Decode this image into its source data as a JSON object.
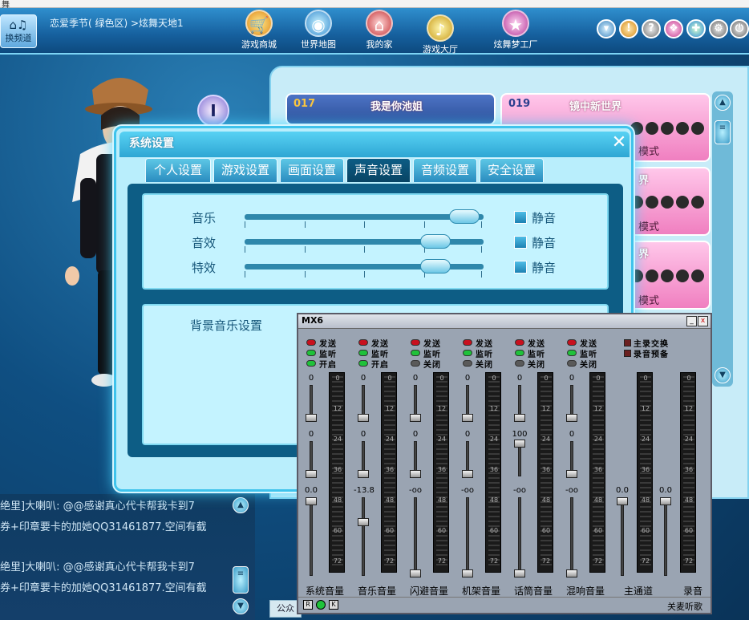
{
  "window": {
    "title_fragment": "舞"
  },
  "header": {
    "switch_channel": "换频道",
    "breadcrumb": "恋爱季节( 绿色区) >炫舞天地1",
    "nav": [
      {
        "label": "游戏商城"
      },
      {
        "label": "世界地图"
      },
      {
        "label": "我的家"
      },
      {
        "label": "游戏大厅"
      },
      {
        "label": "炫舞梦工厂"
      }
    ]
  },
  "rooms": [
    {
      "num": "017",
      "name": "我是你池姐",
      "mode": ""
    },
    {
      "num": "019",
      "name": "镜中新世界",
      "mode": "模式"
    },
    {
      "num": "",
      "name": "界",
      "mode": "模式"
    },
    {
      "num": "",
      "name": "界",
      "mode": "模式"
    }
  ],
  "badge": "I",
  "dialog": {
    "title": "系统设置",
    "close": "✕",
    "tabs": [
      "个人设置",
      "游戏设置",
      "画面设置",
      "声音设置",
      "音频设置",
      "安全设置"
    ],
    "active_tab": "声音设置",
    "sliders": [
      {
        "label": "音乐",
        "value": 0.92,
        "mute": "静音"
      },
      {
        "label": "音效",
        "value": 0.8,
        "mute": "静音"
      },
      {
        "label": "特效",
        "value": 0.8,
        "mute": "静音"
      }
    ],
    "bgm_title": "背景音乐设置"
  },
  "chat": {
    "lines": [
      "绝里]大喇叭: @@感谢真心代卡帮我卡到7",
      "券+印章要卡的加她QQ31461877.空间有截",
      "绝里]大喇叭: @@感谢真心代卡帮我卡到7",
      "券+印章要卡的加她QQ31461877.空间有截"
    ],
    "input_label": "公众"
  },
  "mixer": {
    "title": "MX6",
    "min_btn": "_",
    "close_btn": "x",
    "channels": [
      {
        "name": "系统音量",
        "leds": [
          [
            "r",
            "发送"
          ],
          [
            "g",
            "监听"
          ],
          [
            "g",
            "开启"
          ]
        ],
        "top": "0",
        "mid": "0",
        "bot": "0.0"
      },
      {
        "name": "音乐音量",
        "leds": [
          [
            "r",
            "发送"
          ],
          [
            "g",
            "监听"
          ],
          [
            "g",
            "开启"
          ]
        ],
        "top": "0",
        "mid": "0",
        "bot": "-13.8"
      },
      {
        "name": "闪避音量",
        "leds": [
          [
            "r",
            "发送"
          ],
          [
            "g",
            "监听"
          ],
          [
            "o",
            "关闭"
          ]
        ],
        "top": "0",
        "mid": "0",
        "bot": "-oo"
      },
      {
        "name": "机架音量",
        "leds": [
          [
            "r",
            "发送"
          ],
          [
            "g",
            "监听"
          ],
          [
            "o",
            "关闭"
          ]
        ],
        "top": "0",
        "mid": "0",
        "bot": "-oo"
      },
      {
        "name": "话筒音量",
        "leds": [
          [
            "r",
            "发送"
          ],
          [
            "g",
            "监听"
          ],
          [
            "o",
            "关闭"
          ]
        ],
        "top": "0",
        "mid": "100",
        "bot": "-oo"
      },
      {
        "name": "混响音量",
        "leds": [
          [
            "r",
            "发送"
          ],
          [
            "g",
            "监听"
          ],
          [
            "o",
            "关闭"
          ]
        ],
        "top": "0",
        "mid": "0",
        "bot": "-oo"
      }
    ],
    "master": {
      "name": "主通道",
      "val": "0.0"
    },
    "record": {
      "name": "录音",
      "val": "0.0"
    },
    "options": [
      "主录交换",
      "录音预备"
    ],
    "meter_labels": [
      "0",
      "12",
      "24",
      "36",
      "48",
      "60",
      "72"
    ],
    "bottom_buttons": [
      "R",
      "",
      "K"
    ],
    "status": "关麦听歌"
  }
}
